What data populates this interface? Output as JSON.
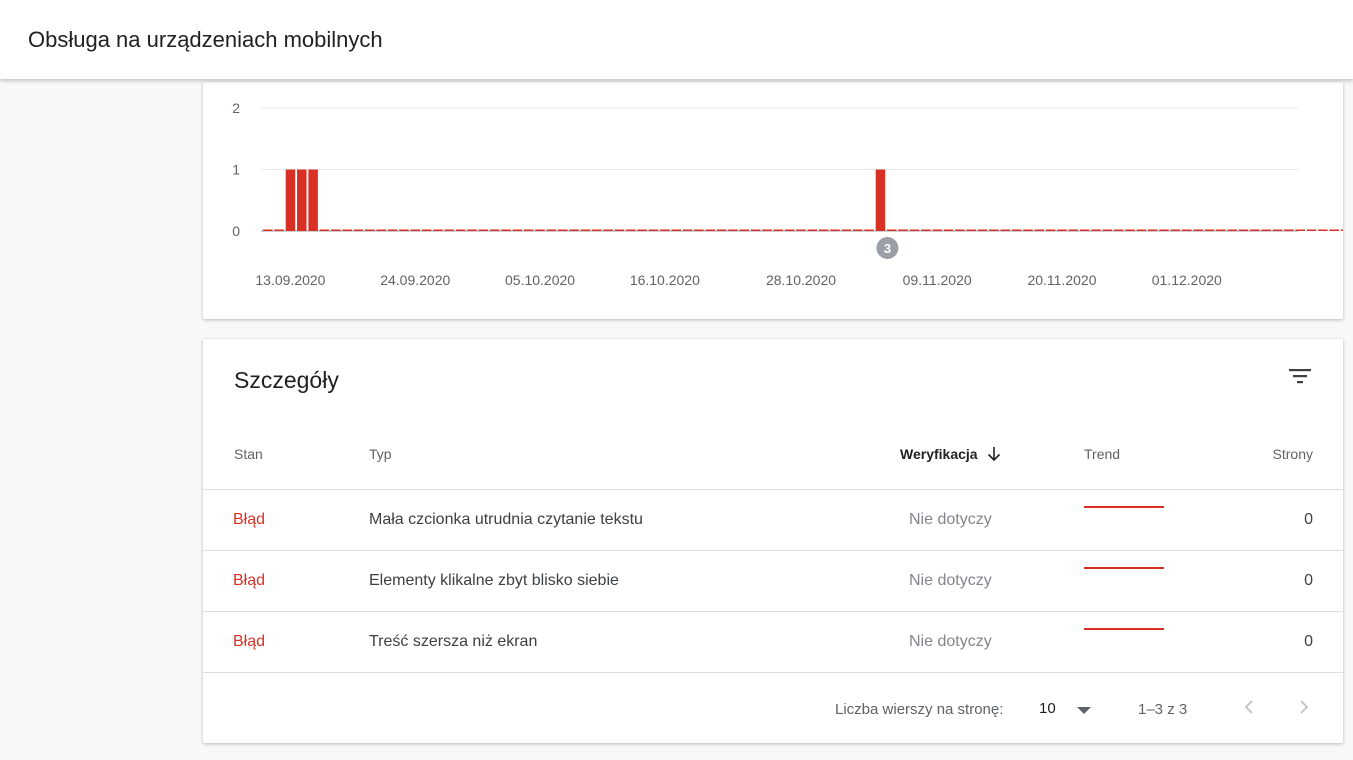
{
  "header": {
    "title": "Obsługa na urządzeniach mobilnych"
  },
  "chart_data": {
    "type": "bar",
    "ylim": [
      0,
      2
    ],
    "yticks": [
      "0",
      "1",
      "2"
    ],
    "xtick_labels": [
      "13.09.2020",
      "24.09.2020",
      "05.10.2020",
      "16.10.2020",
      "28.10.2020",
      "09.11.2020",
      "20.11.2020",
      "01.12.2020"
    ],
    "start_date": "2020-09-11",
    "values": [
      0,
      0,
      1,
      1,
      1,
      0,
      0,
      0,
      0,
      0,
      0,
      0,
      0,
      0,
      0,
      0,
      0,
      0,
      0,
      0,
      0,
      0,
      0,
      0,
      0,
      0,
      0,
      0,
      0,
      0,
      0,
      0,
      0,
      0,
      0,
      0,
      0,
      0,
      0,
      0,
      0,
      0,
      0,
      0,
      0,
      0,
      0,
      0,
      0,
      0,
      0,
      0,
      0,
      0,
      1,
      0,
      0,
      0,
      0,
      0,
      0,
      0,
      0,
      0,
      0,
      0,
      0,
      0,
      0,
      0,
      0,
      0,
      0,
      0,
      0,
      0,
      0,
      0,
      0,
      0,
      0,
      0,
      0,
      0,
      0,
      0,
      0,
      0,
      0,
      0,
      0,
      0,
      0,
      0,
      0,
      0,
      0,
      0,
      0,
      0,
      0,
      0,
      0,
      0,
      0,
      0,
      0,
      0,
      0,
      0,
      0,
      0,
      0,
      0,
      0,
      0,
      0,
      0,
      0,
      0,
      0,
      0,
      0,
      0,
      0,
      0,
      0,
      0,
      0,
      0,
      0,
      0,
      0
    ],
    "bar_color": "#d93025",
    "grid": true,
    "annotation": {
      "text": "3",
      "date_index": 54
    }
  },
  "details": {
    "title": "Szczegóły",
    "filter_icon": "filter-list-icon",
    "columns": {
      "status": "Stan",
      "type": "Typ",
      "verification": "Weryfikacja",
      "trend": "Trend",
      "pages": "Strony"
    },
    "rows": [
      {
        "status": "Błąd",
        "type": "Mała czcionka utrudnia czytanie tekstu",
        "verification": "Nie dotyczy",
        "pages": "0"
      },
      {
        "status": "Błąd",
        "type": "Elementy klikalne zbyt blisko siebie",
        "verification": "Nie dotyczy",
        "pages": "0"
      },
      {
        "status": "Błąd",
        "type": "Treść szersza niż ekran",
        "verification": "Nie dotyczy",
        "pages": "0"
      }
    ],
    "pagination": {
      "rows_per_page_label": "Liczba wierszy na stronę:",
      "rows_per_page_value": "10",
      "range_text": "1–3 z 3"
    }
  },
  "colors": {
    "error": "#d93025",
    "muted": "#80868b"
  }
}
